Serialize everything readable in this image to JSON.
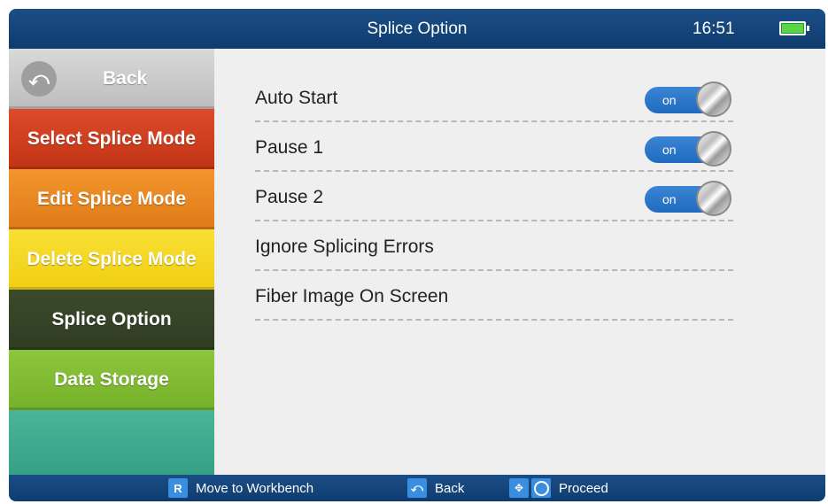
{
  "header": {
    "title": "Splice Option",
    "time": "16:51",
    "battery_icon": "battery-full-icon"
  },
  "sidebar": {
    "items": [
      {
        "label": "Back",
        "icon": "back-arrow-icon",
        "color": "#c9c9c9"
      },
      {
        "label": "Select Splice Mode",
        "color": "#d03d1f"
      },
      {
        "label": "Edit Splice Mode",
        "color": "#ea8821"
      },
      {
        "label": "Delete Splice Mode",
        "color": "#f4d824"
      },
      {
        "label": "Splice Option",
        "color": "#354427",
        "selected": true
      },
      {
        "label": "Data Storage",
        "color": "#82bc33"
      },
      {
        "label": "",
        "color": "#40ab8f"
      }
    ]
  },
  "options": [
    {
      "label": "Auto Start",
      "toggle": "on"
    },
    {
      "label": "Pause 1",
      "toggle": "on"
    },
    {
      "label": "Pause 2",
      "toggle": "on"
    },
    {
      "label": "Ignore Splicing Errors"
    },
    {
      "label": "Fiber Image On Screen"
    }
  ],
  "footer": {
    "hints": [
      {
        "key": "R",
        "label": "Move to Workbench"
      },
      {
        "key_icon": "back-arrow-icon",
        "label": "Back"
      },
      {
        "key_icon": "dpad-ok-icon",
        "label": "Proceed"
      }
    ]
  },
  "colors": {
    "header_bg": "#164580",
    "content_bg": "#efefef",
    "toggle_blue": "#2a77c9"
  }
}
